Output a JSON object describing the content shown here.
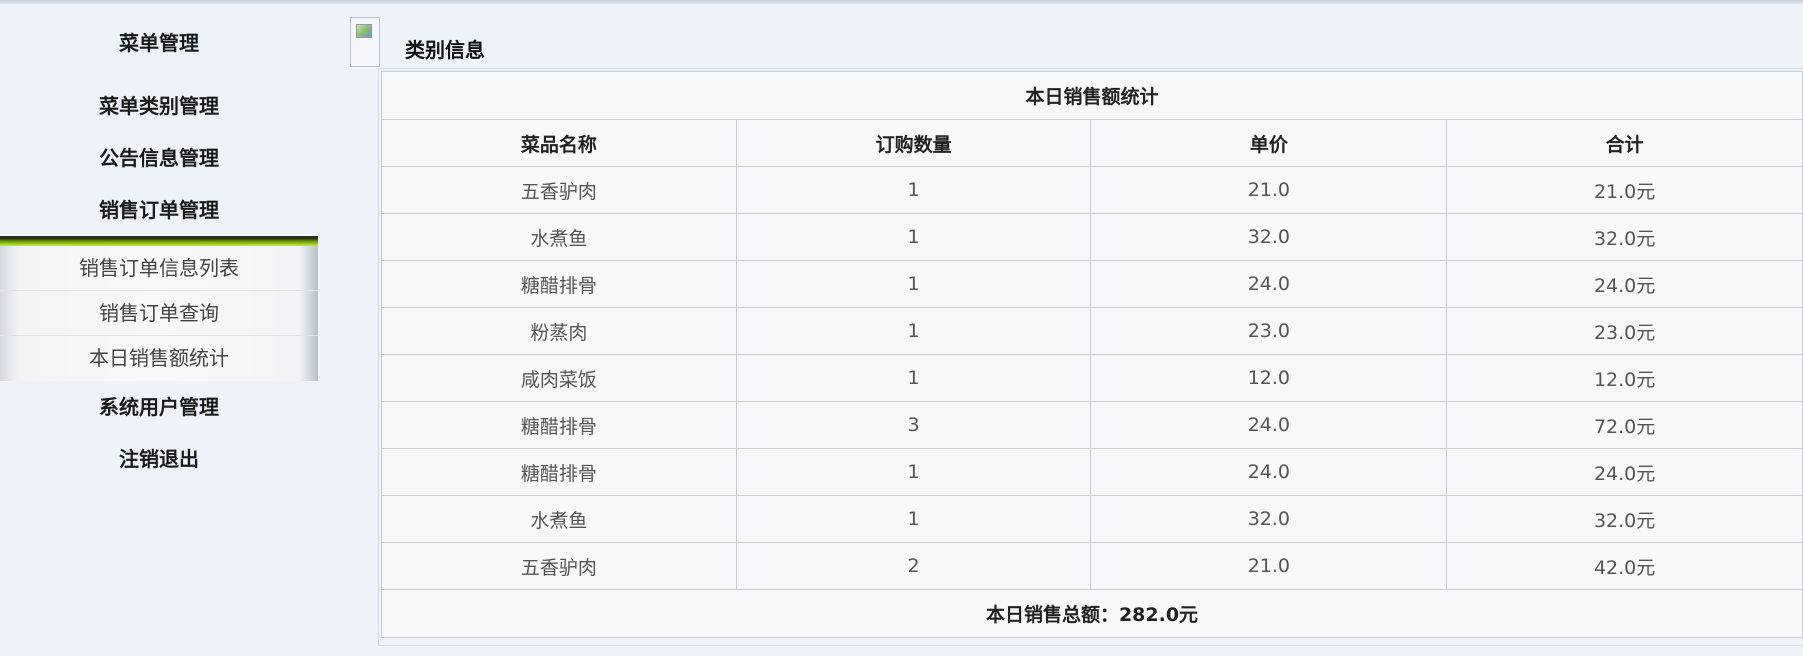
{
  "sidebar": {
    "menus": [
      {
        "label": "菜单管理"
      },
      {
        "label": "菜单类别管理"
      },
      {
        "label": "公告信息管理"
      },
      {
        "label": "销售订单管理"
      }
    ],
    "submenu": [
      {
        "label": "销售订单信息列表"
      },
      {
        "label": "销售订单查询"
      },
      {
        "label": "本日销售额统计"
      }
    ],
    "menus_after": [
      {
        "label": "系统用户管理"
      },
      {
        "label": "注销退出"
      }
    ]
  },
  "main": {
    "section_title": "类别信息",
    "table": {
      "caption": "本日销售额统计",
      "headers": [
        "菜品名称",
        "订购数量",
        "单价",
        "合计"
      ],
      "rows": [
        [
          "五香驴肉",
          "1",
          "21.0",
          "21.0元"
        ],
        [
          "水煮鱼",
          "1",
          "32.0",
          "32.0元"
        ],
        [
          "糖醋排骨",
          "1",
          "24.0",
          "24.0元"
        ],
        [
          "粉蒸肉",
          "1",
          "23.0",
          "23.0元"
        ],
        [
          "咸肉菜饭",
          "1",
          "12.0",
          "12.0元"
        ],
        [
          "糖醋排骨",
          "3",
          "24.0",
          "72.0元"
        ],
        [
          "糖醋排骨",
          "1",
          "24.0",
          "24.0元"
        ],
        [
          "水煮鱼",
          "1",
          "32.0",
          "32.0元"
        ],
        [
          "五香驴肉",
          "2",
          "21.0",
          "42.0元"
        ]
      ],
      "total": "本日销售总额：282.0元"
    }
  }
}
